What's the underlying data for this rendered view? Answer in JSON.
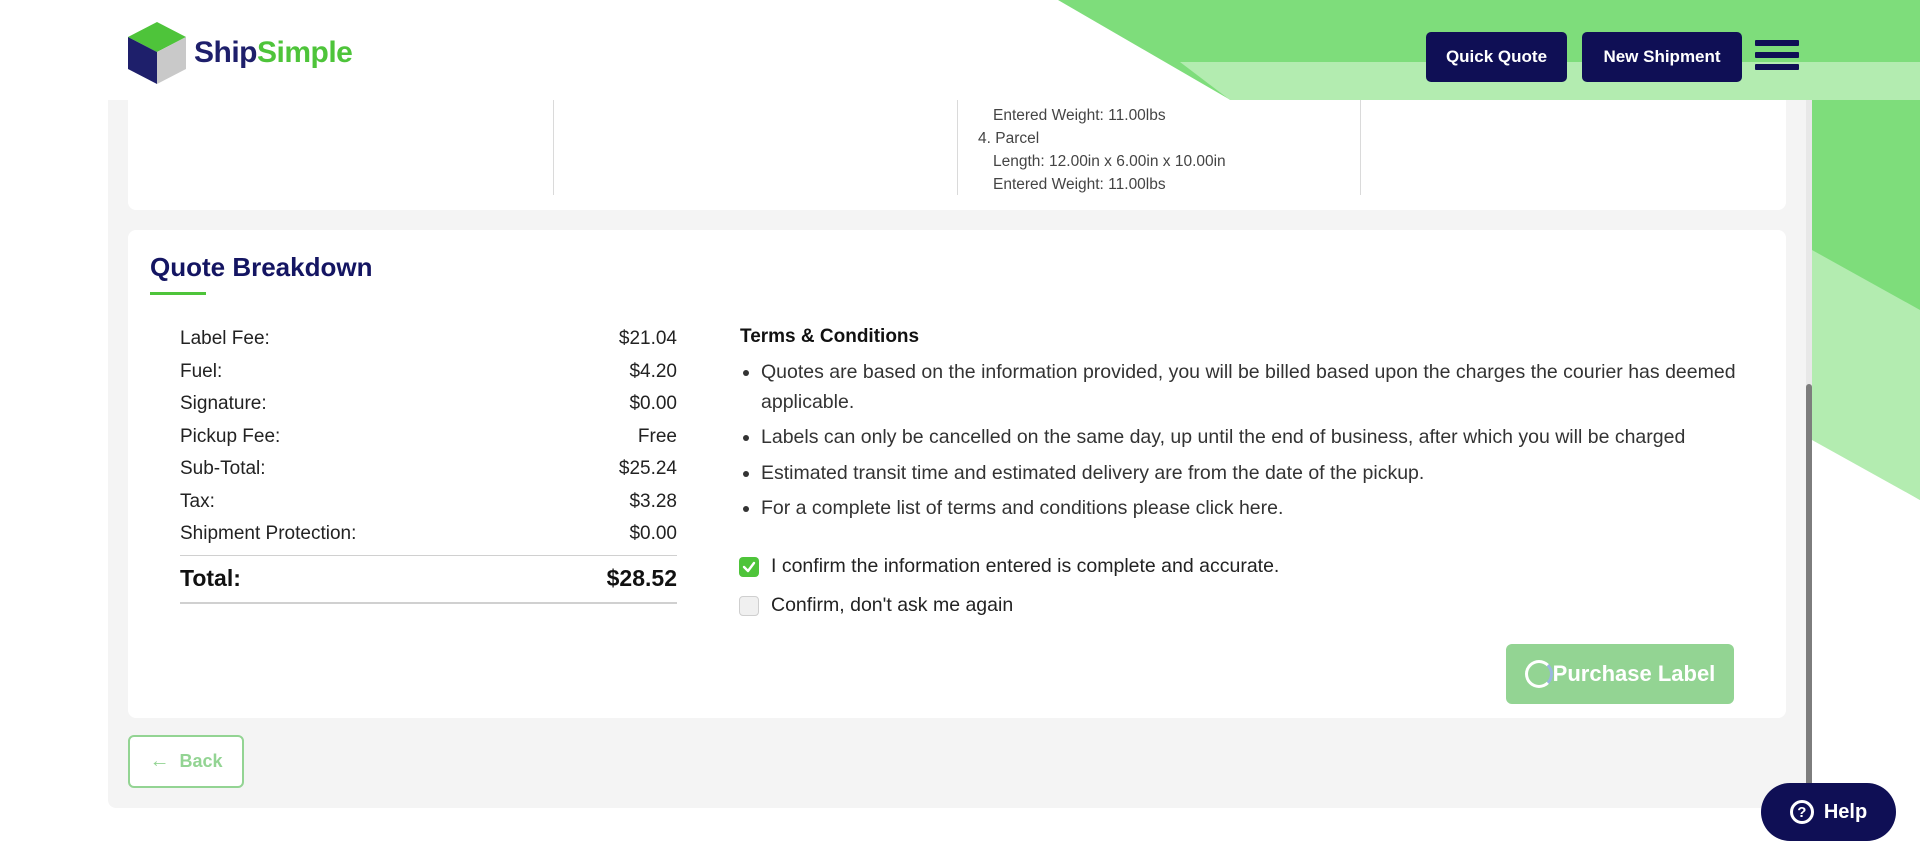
{
  "brand": {
    "name_part1": "Ship",
    "name_part2": "Simple"
  },
  "header": {
    "quick_quote_label": "Quick Quote",
    "new_shipment_label": "New Shipment"
  },
  "parcel_info": {
    "prev_weight": "Entered Weight: 11.00lbs",
    "item_title": "4. Parcel",
    "item_length": "Length: 12.00in x 6.00in x 10.00in",
    "item_weight": "Entered Weight: 11.00lbs"
  },
  "quote": {
    "title": "Quote Breakdown",
    "fees": [
      {
        "label": "Label Fee:",
        "value": "$21.04"
      },
      {
        "label": "Fuel:",
        "value": "$4.20"
      },
      {
        "label": "Signature:",
        "value": "$0.00"
      },
      {
        "label": "Pickup Fee:",
        "value": "Free"
      },
      {
        "label": "Sub-Total:",
        "value": "$25.24"
      },
      {
        "label": "Tax:",
        "value": "$3.28"
      },
      {
        "label": "Shipment Protection:",
        "value": "$0.00"
      }
    ],
    "total_label": "Total:",
    "total_value": "$28.52"
  },
  "terms": {
    "title": "Terms & Conditions",
    "items": [
      "Quotes are based on the information provided, you will be billed based upon the charges the courier has deemed applicable.",
      "Labels can only be cancelled on the same day, up until the end of business, after which you will be charged",
      "Estimated transit time and estimated delivery are from the date of the pickup.",
      "For a complete list of terms and conditions please click here."
    ],
    "confirm_label": "I confirm the information entered is complete and accurate.",
    "confirm_checked": true,
    "dont_ask_label": "Confirm, don't ask me again",
    "dont_ask_checked": false
  },
  "actions": {
    "purchase_label": "Purchase Label",
    "back_label": "Back",
    "help_label": "Help"
  },
  "colors": {
    "navy": "#0f0f55",
    "brand_green": "#4ec43a",
    "light_green": "#93d493",
    "bg_green": "#7edd7b",
    "bg_green_light": "#b3ecb0"
  }
}
